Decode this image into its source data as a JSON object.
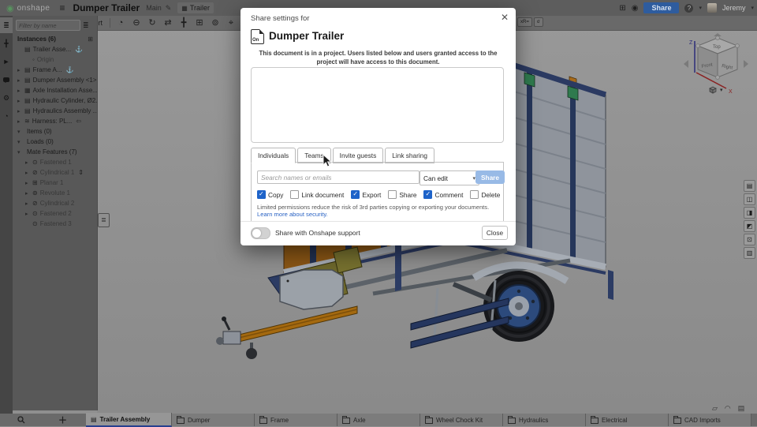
{
  "colors": {
    "accent_blue": "#2e5c9e",
    "share_disabled_blue": "#98bae6",
    "checkbox_blue": "#1e63c9",
    "active_tab_underline": "#27408f",
    "canvas_gray": "#8f8f8f",
    "trailer_navy": "#25365e",
    "trailer_wood": "#8a5615",
    "trailer_metal": "#9aa1ab",
    "drawbar_orange": "#a4690f"
  },
  "topbar": {
    "logo_text": "onshape",
    "logo_glyph": "◉",
    "hamburger_glyph": "≡",
    "title": "Dumper Trailer",
    "workspace": "Main",
    "pencil_glyph": "✎",
    "document_tab_icon": "▦",
    "document_tab": "Trailer",
    "apps_glyph": "⊞",
    "notify_glyph": "◉",
    "share_button": "Share",
    "help_glyph": "?",
    "caret_glyph": "▾",
    "user_name": "Jeremy"
  },
  "toolbar": {
    "undo_glyph": "↶",
    "redo_glyph": "↷",
    "sync_glyph": "◎",
    "insert_icon_glyph": "▣",
    "insert_label": "Insert",
    "buttons": [
      {
        "name": "history-icon",
        "glyph": "◔"
      },
      {
        "name": "mate-icon",
        "glyph": "⊖"
      },
      {
        "name": "revolute-mate-icon",
        "glyph": "↻"
      },
      {
        "name": "slider-mate-icon",
        "glyph": "⇄"
      },
      {
        "name": "fastened-mate-icon",
        "glyph": "╋"
      },
      {
        "name": "planar-mate-icon",
        "glyph": "⊞"
      },
      {
        "name": "ball-mate-icon",
        "glyph": "⊚"
      },
      {
        "name": "cylindrical-mate-icon",
        "glyph": "⌖"
      },
      {
        "name": "parallel-mate-icon",
        "glyph": "∥"
      },
      {
        "name": "tangent-mate-icon",
        "glyph": "⌒"
      },
      {
        "name": "group-icon",
        "glyph": "▣"
      },
      {
        "name": "explode-icon",
        "glyph": "※"
      }
    ],
    "variables_chip": "xR=",
    "measure_chip": "σ"
  },
  "left_rail": {
    "icons": [
      {
        "name": "assembly-tree-icon",
        "glyph": "≣"
      },
      {
        "name": "insert-icon",
        "glyph": "╋"
      },
      {
        "name": "select-icon",
        "glyph": "►"
      },
      {
        "name": "comments-icon",
        "glyph": ""
      },
      {
        "name": "configurations-icon",
        "glyph": "⚙"
      },
      {
        "name": "history-icon",
        "glyph": "◔"
      }
    ]
  },
  "sidebar": {
    "filter_placeholder": "Filter by name",
    "filter_menu_glyph": "≣",
    "instances_header": "Instances (6)",
    "new_instance_glyph": "⊞",
    "panel_handle_glyph": "≣",
    "items": [
      {
        "label": "Trailer Asse...",
        "icon": "▤",
        "chevron": "",
        "suffix": "⚓",
        "cls": ""
      },
      {
        "label": "Origin",
        "icon": "◦",
        "chevron": "",
        "suffix": "",
        "cls": "indent muted"
      },
      {
        "label": "Frame A...",
        "icon": "▤",
        "chevron": "▸",
        "suffix": "⚓",
        "cls": ""
      },
      {
        "label": "Dumper Assembly <1>",
        "icon": "▤",
        "chevron": "▸",
        "suffix": "",
        "cls": ""
      },
      {
        "label": "Axle Installation Asse...",
        "icon": "▦",
        "chevron": "▸",
        "suffix": "",
        "cls": ""
      },
      {
        "label": "Hydraulic Cylinder, Ø2...",
        "icon": "▤",
        "chevron": "▸",
        "suffix": "",
        "cls": ""
      },
      {
        "label": "Hydraulics Assembly ...",
        "icon": "▤",
        "chevron": "▸",
        "suffix": "",
        "cls": ""
      },
      {
        "label": "Harness: PL...",
        "icon": "≋",
        "chevron": "▸",
        "suffix": "⇦",
        "cls": ""
      },
      {
        "label": "Items (0)",
        "icon": "",
        "chevron": "▾",
        "suffix": "",
        "cls": "section"
      },
      {
        "label": "Loads (0)",
        "icon": "",
        "chevron": "▾",
        "suffix": "",
        "cls": "section"
      },
      {
        "label": "Mate Features (7)",
        "icon": "",
        "chevron": "▾",
        "suffix": "",
        "cls": "section"
      },
      {
        "label": "Fastened 1",
        "icon": "⊙",
        "chevron": "▸",
        "suffix": "",
        "cls": "indent muted"
      },
      {
        "label": "Cylindrical 1",
        "icon": "⊘",
        "chevron": "▸",
        "suffix": "⇕",
        "cls": "indent muted"
      },
      {
        "label": "Planar 1",
        "icon": "⊞",
        "chevron": "▸",
        "suffix": "",
        "cls": "indent muted"
      },
      {
        "label": "Revolute 1",
        "icon": "⊚",
        "chevron": "▸",
        "suffix": "",
        "cls": "indent muted"
      },
      {
        "label": "Cylindrical 2",
        "icon": "⊘",
        "chevron": "▸",
        "suffix": "",
        "cls": "indent muted"
      },
      {
        "label": "Fastened 2",
        "icon": "⊙",
        "chevron": "▸",
        "suffix": "",
        "cls": "indent muted"
      },
      {
        "label": "Fastened 3",
        "icon": "⊙",
        "chevron": "",
        "suffix": "",
        "cls": "indent muted"
      }
    ]
  },
  "dialog": {
    "header_label": "Share settings for",
    "close_glyph": "✕",
    "doc_icon_text": "On",
    "title": "Dumper Trailer",
    "description": "This document is in a project. Users listed below and users granted access to the project will have access to this document.",
    "tabs": [
      {
        "label": "Individuals",
        "state": "active"
      },
      {
        "label": "Teams",
        "state": ""
      },
      {
        "label": "Invite guests",
        "state": ""
      },
      {
        "label": "Link sharing",
        "state": ""
      }
    ],
    "search_placeholder": "Search names or emails",
    "permission_value": "Can edit",
    "select_caret": "▾",
    "share_button": "Share",
    "checkboxes": [
      {
        "label": "Copy",
        "state": "checked"
      },
      {
        "label": "Link document",
        "state": ""
      },
      {
        "label": "Export",
        "state": "checked"
      },
      {
        "label": "Share",
        "state": ""
      },
      {
        "label": "Comment",
        "state": "checked"
      },
      {
        "label": "Delete",
        "state": ""
      }
    ],
    "note_text": "Limited permissions reduce the risk of 3rd parties copying or exporting your documents.",
    "note_link": "Learn more about security.",
    "support_toggle_label": "Share with Onshape support",
    "close_button": "Close"
  },
  "canvas": {
    "viewcube": {
      "top": "Top",
      "front": "Front",
      "right": "Right",
      "axis_z": "Z",
      "axis_x": "X"
    },
    "view_menu_caret": "▾",
    "right_rail_icons": [
      {
        "name": "bom-table-icon",
        "glyph": "▤"
      },
      {
        "name": "versions-panel-icon",
        "glyph": "◫"
      },
      {
        "name": "section-view-icon",
        "glyph": "◨"
      },
      {
        "name": "appearance-panel-icon",
        "glyph": "◩"
      },
      {
        "name": "render-panel-icon",
        "glyph": "⊡"
      },
      {
        "name": "custom-tables-icon",
        "glyph": "▥"
      }
    ],
    "status_icons": [
      {
        "name": "performance-icon",
        "glyph": "▱"
      },
      {
        "name": "hidden-tabs-icon",
        "glyph": "◠"
      },
      {
        "name": "tab-manager-icon",
        "glyph": "▤"
      }
    ]
  },
  "tabbar": {
    "plus_glyph": "＋",
    "active_tab": {
      "label": "Trailer Assembly",
      "icon": "▤"
    },
    "tabs": [
      {
        "label": "Dumper"
      },
      {
        "label": "Frame"
      },
      {
        "label": "Axle"
      },
      {
        "label": "Wheel Chock Kit"
      },
      {
        "label": "Hydraulics"
      },
      {
        "label": "Electrical"
      },
      {
        "label": "CAD Imports"
      }
    ]
  }
}
